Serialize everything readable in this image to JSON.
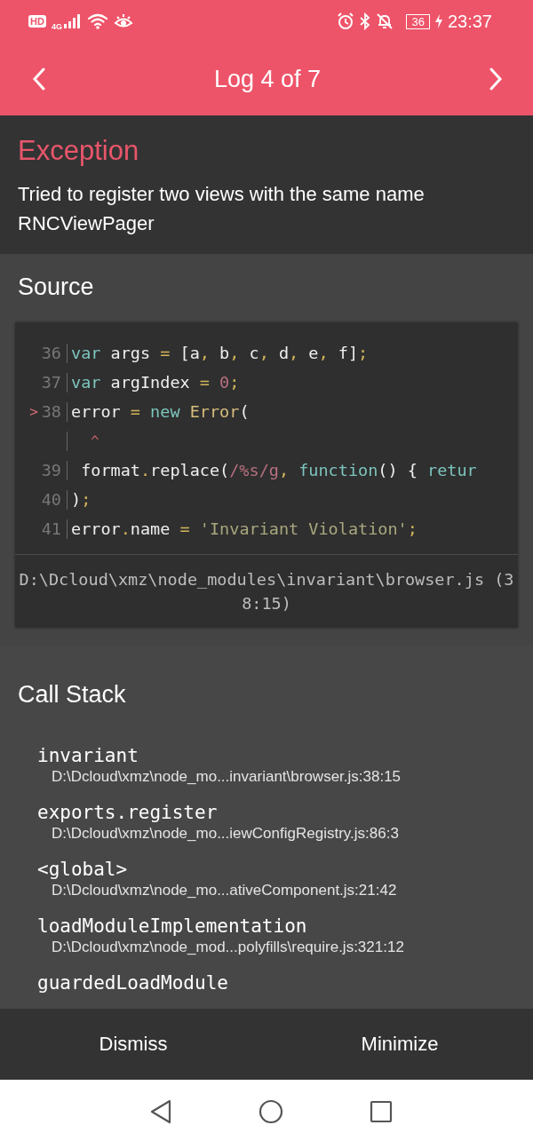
{
  "status_bar": {
    "hd": "HD",
    "network": "4G",
    "battery": "36",
    "time": "23:37"
  },
  "header": {
    "title": "Log 4 of 7"
  },
  "exception": {
    "title": "Exception",
    "message": "Tried to register two views with the same name RNCViewPager"
  },
  "source": {
    "title": "Source",
    "lines": [
      {
        "kind": "code",
        "number": "36",
        "tokens": [
          {
            "kind": "kw",
            "t": "var"
          },
          {
            "kind": "plain",
            "t": " args "
          },
          {
            "kind": "punct",
            "t": "= "
          },
          {
            "kind": "plain",
            "t": "[a"
          },
          {
            "kind": "punct",
            "t": ", "
          },
          {
            "kind": "plain",
            "t": "b"
          },
          {
            "kind": "punct",
            "t": ", "
          },
          {
            "kind": "plain",
            "t": "c"
          },
          {
            "kind": "punct",
            "t": ", "
          },
          {
            "kind": "plain",
            "t": "d"
          },
          {
            "kind": "punct",
            "t": ", "
          },
          {
            "kind": "plain",
            "t": "e"
          },
          {
            "kind": "punct",
            "t": ", "
          },
          {
            "kind": "plain",
            "t": "f]"
          },
          {
            "kind": "punct",
            "t": ";"
          }
        ]
      },
      {
        "kind": "code",
        "number": "37",
        "tokens": [
          {
            "kind": "kw",
            "t": "var"
          },
          {
            "kind": "plain",
            "t": " argIndex "
          },
          {
            "kind": "punct",
            "t": "= "
          },
          {
            "kind": "num",
            "t": "0"
          },
          {
            "kind": "punct",
            "t": ";"
          }
        ]
      },
      {
        "kind": "code",
        "number": "38",
        "marker": ">",
        "tokens": [
          {
            "kind": "plain",
            "t": "error "
          },
          {
            "kind": "punct",
            "t": "= "
          },
          {
            "kind": "kw",
            "t": "new "
          },
          {
            "kind": "cls",
            "t": "Error"
          },
          {
            "kind": "plain",
            "t": "("
          }
        ]
      },
      {
        "kind": "caret",
        "caret": "^"
      },
      {
        "kind": "code",
        "number": "39",
        "tokens": [
          {
            "kind": "plain",
            "t": " format"
          },
          {
            "kind": "punct",
            "t": "."
          },
          {
            "kind": "plain",
            "t": "replace("
          },
          {
            "kind": "num",
            "t": "/%s/g"
          },
          {
            "kind": "punct",
            "t": ", "
          },
          {
            "kind": "kw",
            "t": "function"
          },
          {
            "kind": "plain",
            "t": "() { "
          },
          {
            "kind": "kw",
            "t": "retur"
          }
        ]
      },
      {
        "kind": "code",
        "number": "40",
        "tokens": [
          {
            "kind": "plain",
            "t": ")"
          },
          {
            "kind": "punct",
            "t": ";"
          }
        ]
      },
      {
        "kind": "code",
        "number": "41",
        "tokens": [
          {
            "kind": "plain",
            "t": "error"
          },
          {
            "kind": "punct",
            "t": "."
          },
          {
            "kind": "plain",
            "t": "name "
          },
          {
            "kind": "punct",
            "t": "= "
          },
          {
            "kind": "str",
            "t": "'Invariant Violation'"
          },
          {
            "kind": "punct",
            "t": ";"
          }
        ]
      }
    ],
    "file": "D:\\Dcloud\\xmz\\node_modules\\invariant\\browser.js (38:15)"
  },
  "call_stack": {
    "title": "Call Stack",
    "frames": [
      {
        "name": "invariant",
        "location": "D:\\Dcloud\\xmz\\node_mo...invariant\\browser.js:38:15"
      },
      {
        "name": "exports.register",
        "location": "D:\\Dcloud\\xmz\\node_mo...iewConfigRegistry.js:86:3"
      },
      {
        "name": "<global>",
        "location": "D:\\Dcloud\\xmz\\node_mo...ativeComponent.js:21:42"
      },
      {
        "name": "loadModuleImplementation",
        "location": "D:\\Dcloud\\xmz\\node_mod...polyfills\\require.js:321:12"
      },
      {
        "name": "guardedLoadModule"
      }
    ]
  },
  "buttons": [
    "Dismiss",
    "Minimize"
  ]
}
